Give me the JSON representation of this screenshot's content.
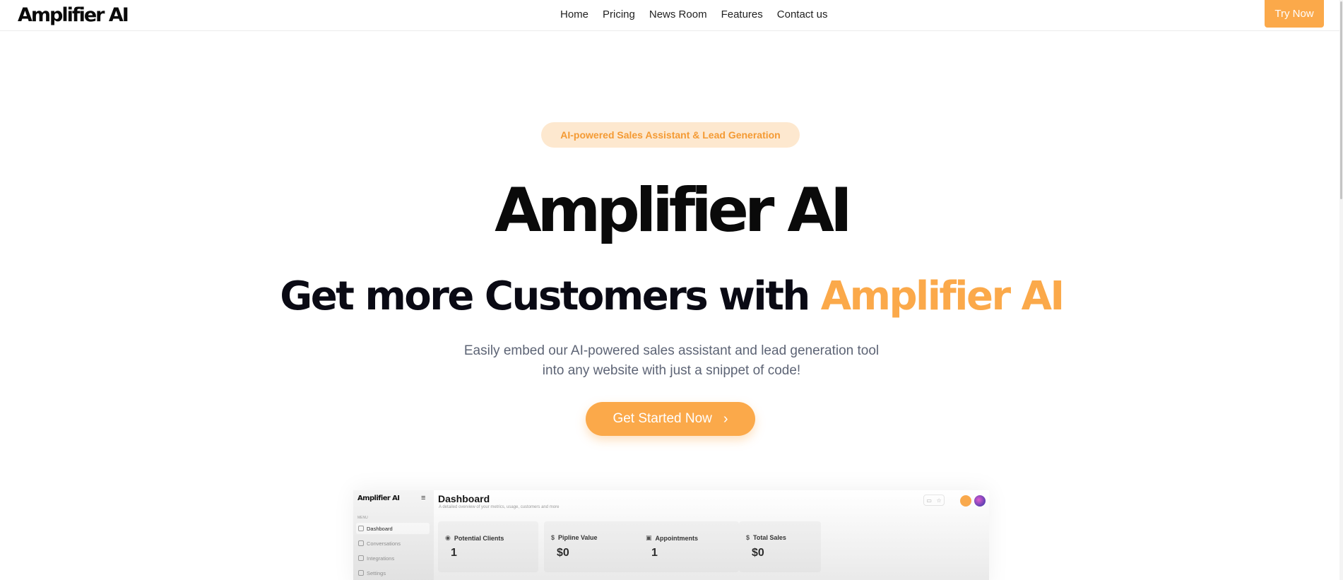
{
  "nav": {
    "logo": "Amplifier AI",
    "links": [
      "Home",
      "Pricing",
      "News Room",
      "Features",
      "Contact us"
    ],
    "cta": "Try Now"
  },
  "hero": {
    "badge": "AI-powered Sales Assistant & Lead Generation",
    "logo_text": "Amplifier AI",
    "headline_main": "Get more Customers with ",
    "headline_accent": "Amplifier AI",
    "sub_line1": "Easily embed our AI-powered sales assistant and lead generation tool",
    "sub_line2": "into any website with just a snippet of code!",
    "cta_label": "Get Started Now",
    "cta_icon": "chevron-right-icon"
  },
  "preview": {
    "logo": "Amplifier AI",
    "menu_label": "MENU",
    "sidebar": [
      {
        "label": "Dashboard",
        "icon": "grid-icon"
      },
      {
        "label": "Conversations",
        "icon": "chat-icon"
      },
      {
        "label": "Integrations",
        "icon": "plug-icon"
      },
      {
        "label": "Settings",
        "icon": "gear-icon"
      }
    ],
    "title": "Dashboard",
    "subtitle": "A detailed overview of your metrics, usage, customers and more",
    "cards": [
      {
        "label": "Potential Clients",
        "value": "1",
        "icon": "badge-icon"
      },
      {
        "label": "Pipline Value",
        "value": "$0",
        "icon": "dollar-icon"
      },
      {
        "label": "Appointments",
        "value": "1",
        "icon": "calendar-icon"
      },
      {
        "label": "Total Sales",
        "value": "$0",
        "icon": "dollar-icon"
      }
    ]
  },
  "colors": {
    "accent": "#fba94a",
    "badge_bg": "#fde8cf",
    "text_dark": "#0a0a14",
    "text_muted": "#5d6475"
  }
}
